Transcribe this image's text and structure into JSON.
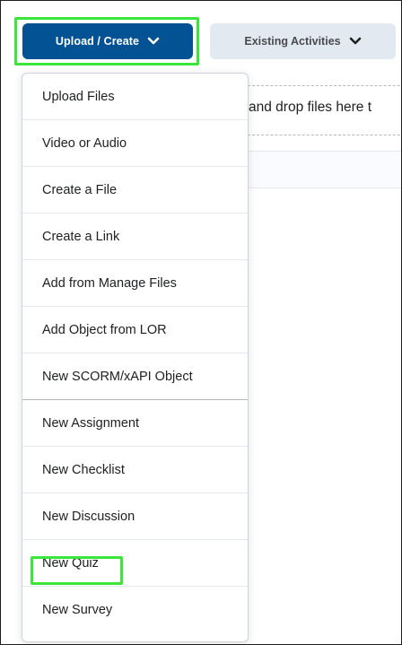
{
  "toolbar": {
    "upload_create_label": "Upload / Create",
    "existing_activities_label": "Existing Activities"
  },
  "dropzone": {
    "text": "and drop files here t"
  },
  "menu": {
    "items": [
      {
        "label": "Upload Files"
      },
      {
        "label": "Video or Audio"
      },
      {
        "label": "Create a File"
      },
      {
        "label": "Create a Link"
      },
      {
        "label": "Add from Manage Files"
      },
      {
        "label": "Add Object from LOR"
      },
      {
        "label": "New SCORM/xAPI Object"
      },
      {
        "label": "New Assignment"
      },
      {
        "label": "New Checklist"
      },
      {
        "label": "New Discussion"
      },
      {
        "label": "New Quiz"
      },
      {
        "label": "New Survey"
      }
    ]
  },
  "colors": {
    "primary_button": "#035293",
    "secondary_button": "#e3e9f1",
    "highlight": "#39e639"
  }
}
